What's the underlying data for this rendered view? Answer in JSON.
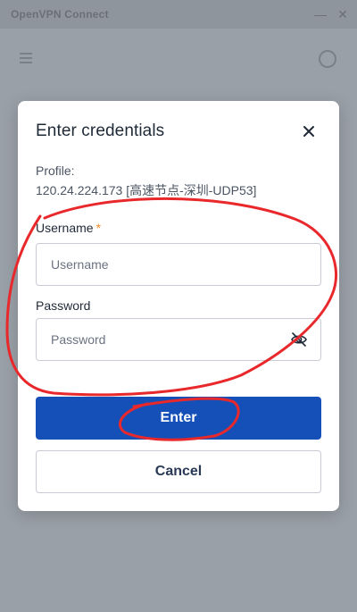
{
  "window": {
    "title": "OpenVPN Connect",
    "minimize_icon": "minus-icon",
    "close_icon": "close-icon"
  },
  "background": {
    "menu_icon": "hamburger-menu-icon",
    "import_icon": "import-profile-icon"
  },
  "dialog": {
    "title": "Enter credentials",
    "close_icon": "close-icon",
    "profile_label": "Profile:",
    "profile_value": "120.24.224.173 [高速节点-深圳-UDP53]",
    "username_label": "Username",
    "required_marker": "*",
    "username_placeholder": "Username",
    "username_value": "",
    "password_label": "Password",
    "password_placeholder": "Password",
    "password_value": "",
    "password_toggle_icon": "eye-slash-icon",
    "enter_label": "Enter",
    "cancel_label": "Cancel"
  },
  "colors": {
    "primary_button": "#1550b8",
    "required_star": "#f08a24",
    "annotation": "#e8282b",
    "overlay": "#9aa0a8"
  }
}
